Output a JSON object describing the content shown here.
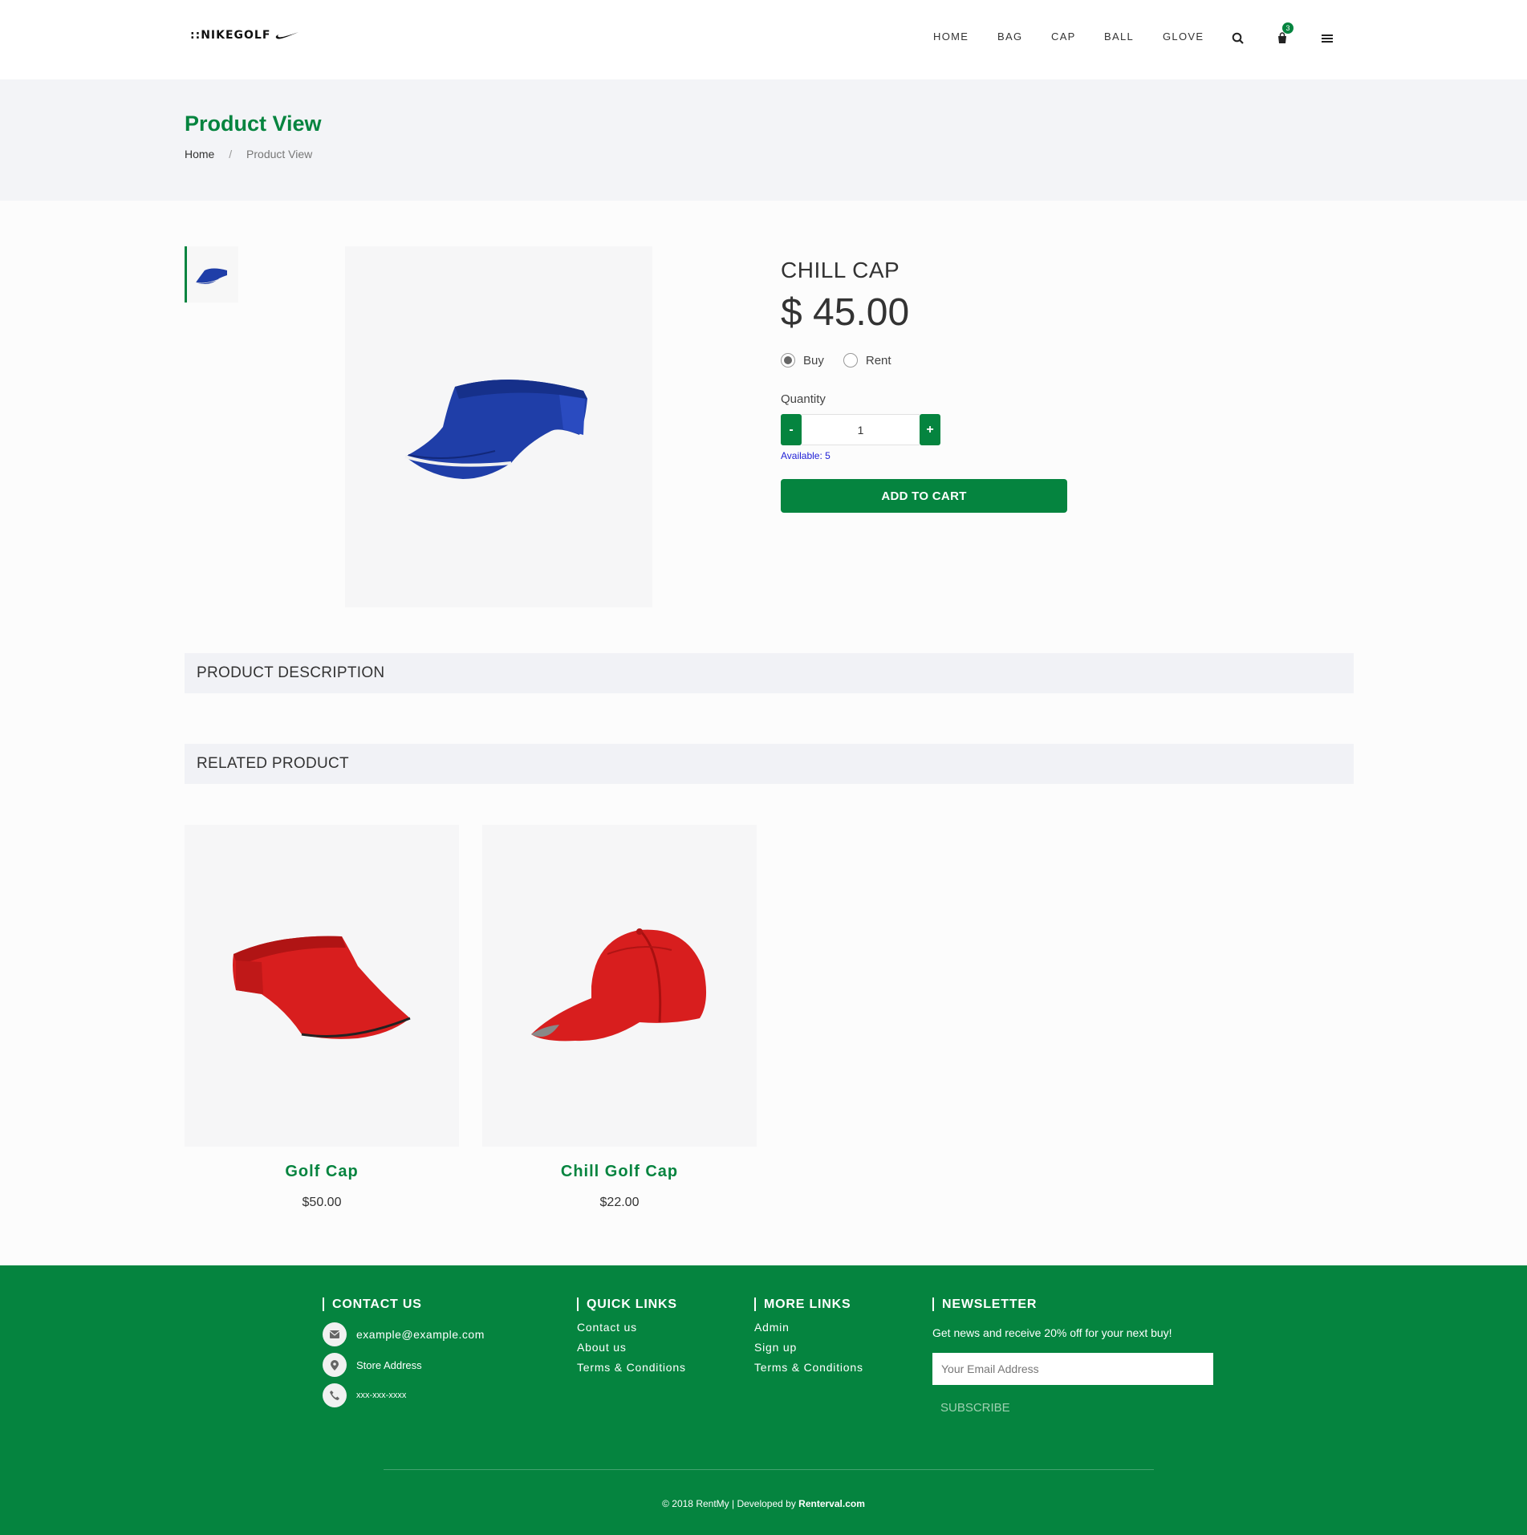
{
  "header": {
    "logo_text": "::NIKEGOLF",
    "nav": [
      "HOME",
      "BAG",
      "CAP",
      "BALL",
      "GLOVE"
    ],
    "cart_count": "3"
  },
  "banner": {
    "title": "Product View",
    "breadcrumb_home": "Home",
    "breadcrumb_sep": "/",
    "breadcrumb_current": "Product View"
  },
  "product": {
    "name": "CHILL CAP",
    "price": "$ 45.00",
    "options": [
      "Buy",
      "Rent"
    ],
    "selected_option": "Buy",
    "quantity_label": "Quantity",
    "quantity_value": "1",
    "minus_label": "-",
    "plus_label": "+",
    "available": "Available: 5",
    "add_to_cart": "ADD TO CART",
    "image_color": "#1f3ea8"
  },
  "sections": {
    "description": "PRODUCT DESCRIPTION",
    "related": "RELATED PRODUCT"
  },
  "related": [
    {
      "name": "Golf Cap",
      "price": "$50.00",
      "image": "red-visor"
    },
    {
      "name": "Chill Golf Cap",
      "price": "$22.00",
      "image": "red-baseball-cap"
    }
  ],
  "footer": {
    "contact_heading": "CONTACT US",
    "email": "example@example.com",
    "address": "Store Address",
    "phone": "xxx-xxx-xxxx",
    "quick_heading": "QUICK LINKS",
    "quick_links": [
      "Contact us",
      "About us",
      "Terms & Conditions"
    ],
    "more_heading": "MORE LINKS",
    "more_links": [
      "Admin",
      "Sign up",
      "Terms & Conditions"
    ],
    "newsletter_heading": "NEWSLETTER",
    "newsletter_text": "Get news and receive 20% off for your next buy!",
    "email_placeholder": "Your Email Address",
    "subscribe": "SUBSCRIBE",
    "copyright": "© 2018 RentMy | Developed by",
    "developer": "Renterval.com"
  },
  "colors": {
    "brand_green": "#05843f",
    "banner_bg": "#f3f4f7",
    "available_blue": "#2121d6"
  }
}
